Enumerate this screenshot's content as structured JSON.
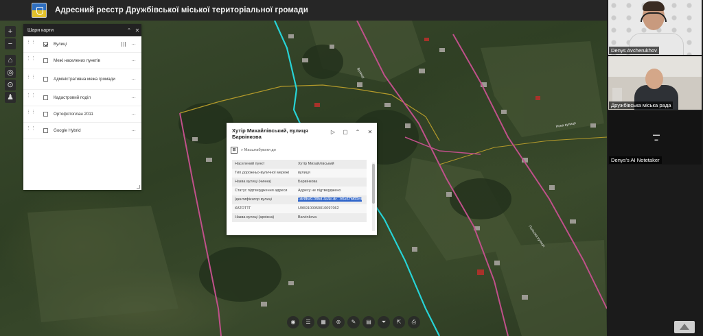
{
  "header": {
    "title": "Адресний реєстр Дружбівської міської територіальної громади"
  },
  "map_tools": {
    "zoom_in": "+",
    "zoom_out": "−",
    "home": "⌂",
    "locate": "◎",
    "compass": "⊙",
    "person": "♟"
  },
  "layers_panel": {
    "title": "Шари карти",
    "collapse": "⌃",
    "close": "✕",
    "layers": [
      {
        "label": "Вулиці",
        "checked": true
      },
      {
        "label": "Межі населених пунктів",
        "checked": false
      },
      {
        "label": "Адміністративна межа громади",
        "checked": false
      },
      {
        "label": "Кадастровий поділ",
        "checked": false
      },
      {
        "label": "Ортофотоплан 2011",
        "checked": false
      },
      {
        "label": "Google Hybrid",
        "checked": false
      }
    ],
    "more": "···"
  },
  "popup": {
    "title": "Хутір Михайлівський, вулиця Барвінкова",
    "zoom_label": "Масштабувати до",
    "rows": [
      {
        "key": "Населений пункт",
        "value": "Хутір Михайлівський"
      },
      {
        "key": "Тип дорожньо-вуличної мережі",
        "value": "вулиця"
      },
      {
        "key": "Назва вулиці (чинна)",
        "value": "Барвінкова"
      },
      {
        "key": "Статус підтвердження адреси",
        "value": "Адресу не підтверджено"
      },
      {
        "key": "Ідентифікатор вулиці",
        "value": "1dc8ba9-08bd-4a4e-dc...b5e67bf00cd"
      },
      {
        "key": "КАТОТТГ",
        "value": "UA59100050010097062"
      },
      {
        "key": "Назва вулиці (архівна)",
        "value": "Barvinkova"
      }
    ]
  },
  "map_labels": {
    "street_1": "Вулиця",
    "street_2": "Нова вулиця",
    "street_3": "Польова вулиця"
  },
  "bottom_toolbar": [
    "◉",
    "☰",
    "▦",
    "⊚",
    "✎",
    "▤",
    "⏷",
    "⇱",
    "⎙"
  ],
  "participants": [
    {
      "name": "Denys Avcherukhov"
    },
    {
      "name": "Дружбівська міська рада"
    },
    {
      "name": "Denys's AI Notetaker"
    }
  ],
  "colors": {
    "street_cyan": "#27d3d6",
    "street_pink": "#c0508a",
    "boundary_yellow": "#b49a2a",
    "selection_blue": "#2b62c9"
  }
}
